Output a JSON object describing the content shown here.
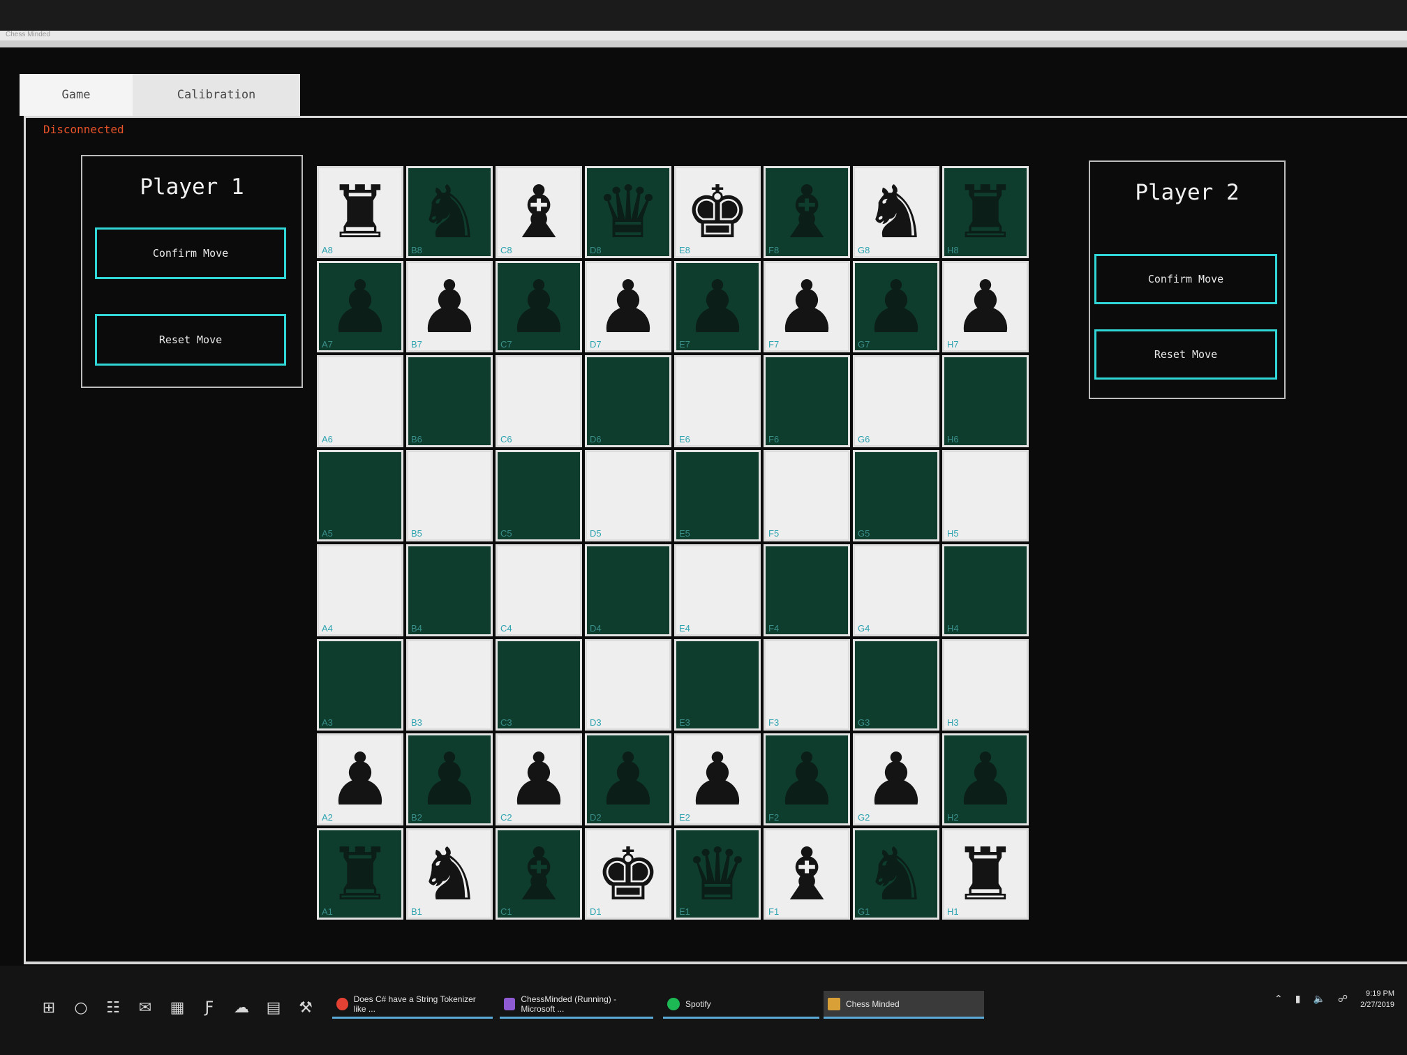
{
  "window": {
    "title": "Chess Minded"
  },
  "tabs": [
    {
      "label": "Game",
      "active": true
    },
    {
      "label": "Calibration",
      "active": false
    }
  ],
  "status": {
    "text": "Disconnected",
    "color": "#e8532a"
  },
  "player1": {
    "title": "Player 1",
    "confirm_label": "Confirm Move",
    "reset_label": "Reset Move"
  },
  "player2": {
    "title": "Player 2",
    "confirm_label": "Confirm Move",
    "reset_label": "Reset Move"
  },
  "colors": {
    "accent": "#31d6d6",
    "dark_square": "#0e3d2e",
    "light_square": "#eeeeee",
    "label": "#2ea3b0"
  },
  "board": {
    "files": [
      "A",
      "B",
      "C",
      "D",
      "E",
      "F",
      "G",
      "H"
    ],
    "ranks": [
      "8",
      "7",
      "6",
      "5",
      "4",
      "3",
      "2",
      "1"
    ],
    "pieces": [
      [
        "rook",
        "knight",
        "bishop",
        "queen",
        "king",
        "bishop",
        "knight",
        "rook"
      ],
      [
        "pawn",
        "pawn",
        "pawn",
        "pawn",
        "pawn",
        "pawn",
        "pawn",
        "pawn"
      ],
      [
        "",
        "",
        "",
        "",
        "",
        "",
        "",
        ""
      ],
      [
        "",
        "",
        "",
        "",
        "",
        "",
        "",
        ""
      ],
      [
        "",
        "",
        "",
        "",
        "",
        "",
        "",
        ""
      ],
      [
        "",
        "",
        "",
        "",
        "",
        "",
        "",
        ""
      ],
      [
        "pawn",
        "pawn",
        "pawn",
        "pawn",
        "pawn",
        "pawn",
        "pawn",
        "pawn"
      ],
      [
        "rook",
        "knight",
        "bishop",
        "king",
        "queen",
        "bishop",
        "knight",
        "rook"
      ]
    ]
  },
  "taskbar": {
    "icons": [
      "windows-start-icon",
      "search-circle-icon",
      "task-view-icon",
      "mail-icon",
      "calculator-icon",
      "filezilla-icon",
      "cloud-app-icon",
      "file-explorer-icon",
      "network-tool-icon"
    ],
    "apps": [
      {
        "label": "Does C# have a String Tokenizer like ...",
        "icon": "chrome-icon",
        "icon_color": "#e34133"
      },
      {
        "label": "ChessMinded (Running) - Microsoft ...",
        "icon": "visual-studio-icon",
        "icon_color": "#8e5bd3"
      },
      {
        "label": "Spotify",
        "icon": "spotify-icon",
        "icon_color": "#1db954"
      },
      {
        "label": "Chess Minded",
        "icon": "chess-minded-icon",
        "icon_color": "#d9a037",
        "active": true
      }
    ],
    "clock": {
      "time": "9:19 PM",
      "date": "2/27/2019"
    }
  }
}
